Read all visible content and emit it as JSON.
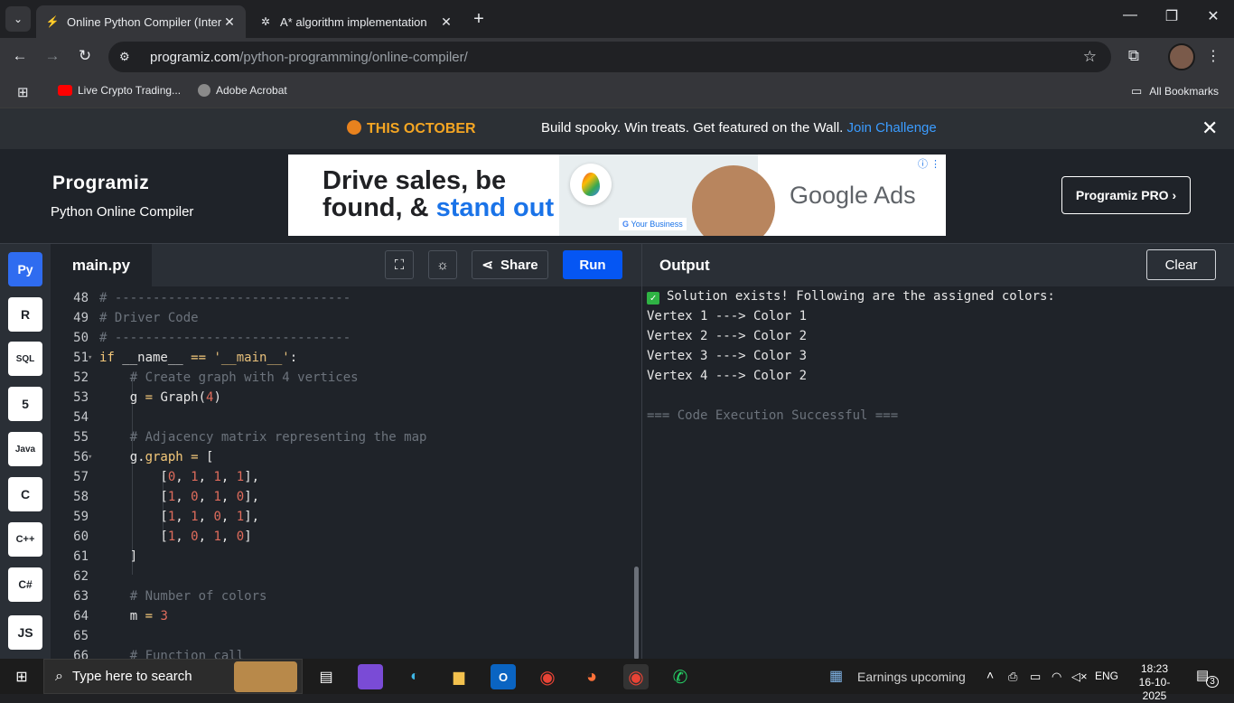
{
  "browser": {
    "tabs": [
      {
        "title": "Online Python Compiler (Interp",
        "close": "✕"
      },
      {
        "title": "A* algorithm implementation",
        "close": "✕"
      }
    ],
    "new_tab": "+",
    "url_host": "programiz.com",
    "url_path": "/python-programming/online-compiler/",
    "bookmarks": [
      "Live Crypto Trading...",
      "Adobe Acrobat"
    ],
    "all_bookmarks": "All Bookmarks"
  },
  "banner": {
    "highlight": "THIS OCTOBER",
    "message": "Build spooky. Win treats. Get featured on the Wall.",
    "link": "Join Challenge",
    "close": "✕"
  },
  "header": {
    "logo": "Programiz",
    "subtitle": "Python Online Compiler",
    "pro_button": "Programiz PRO ›"
  },
  "ad": {
    "line1": "Drive sales, be",
    "line2_plain": "found, & ",
    "line2_blue": "stand out",
    "brand": "Google Ads",
    "your_business": "Your Business"
  },
  "languages": [
    "Py",
    "R",
    "SQL",
    "5",
    "Java",
    "C",
    "C++",
    "C#",
    "JS"
  ],
  "editor": {
    "filename": "main.py",
    "share": "Share",
    "run": "Run",
    "lines": [
      {
        "n": "48",
        "fold": "",
        "html": "<span class='cm'># -------------------------------</span>"
      },
      {
        "n": "49",
        "fold": "",
        "html": "<span class='cm'># Driver Code</span>"
      },
      {
        "n": "50",
        "fold": "",
        "html": "<span class='cm'># -------------------------------</span>"
      },
      {
        "n": "51",
        "fold": "▾",
        "html": "<span class='kw'>if</span> __name__ <span class='kw'>==</span> <span class='st'>'__main__'</span>:"
      },
      {
        "n": "52",
        "fold": "",
        "html": "    <span class='cm'># Create graph with 4 vertices</span>"
      },
      {
        "n": "53",
        "fold": "",
        "html": "    g <span class='kw'>=</span> Graph(<span class='nu'>4</span>)"
      },
      {
        "n": "54",
        "fold": "",
        "html": ""
      },
      {
        "n": "55",
        "fold": "",
        "html": "    <span class='cm'># Adjacency matrix representing the map</span>"
      },
      {
        "n": "56",
        "fold": "▾",
        "html": "    g.<span class='kw'>graph</span> <span class='kw'>=</span> ["
      },
      {
        "n": "57",
        "fold": "",
        "html": "        [<span class='nu'>0</span>, <span class='nu'>1</span>, <span class='nu'>1</span>, <span class='nu'>1</span>],"
      },
      {
        "n": "58",
        "fold": "",
        "html": "        [<span class='nu'>1</span>, <span class='nu'>0</span>, <span class='nu'>1</span>, <span class='nu'>0</span>],"
      },
      {
        "n": "59",
        "fold": "",
        "html": "        [<span class='nu'>1</span>, <span class='nu'>1</span>, <span class='nu'>0</span>, <span class='nu'>1</span>],"
      },
      {
        "n": "60",
        "fold": "",
        "html": "        [<span class='nu'>1</span>, <span class='nu'>0</span>, <span class='nu'>1</span>, <span class='nu'>0</span>]"
      },
      {
        "n": "61",
        "fold": "",
        "html": "    ]"
      },
      {
        "n": "62",
        "fold": "",
        "html": ""
      },
      {
        "n": "63",
        "fold": "",
        "html": "    <span class='cm'># Number of colors</span>"
      },
      {
        "n": "64",
        "fold": "",
        "html": "    m <span class='kw'>=</span> <span class='nu'>3</span>"
      },
      {
        "n": "65",
        "fold": "",
        "html": ""
      },
      {
        "n": "66",
        "fold": "",
        "html": "    <span class='cm'># Function call</span>"
      }
    ]
  },
  "output": {
    "title": "Output",
    "clear": "Clear",
    "first_line": "Solution exists! Following are the assigned colors:",
    "lines": [
      "Vertex 1 ---> Color 1",
      "Vertex 2 ---> Color 2",
      "Vertex 3 ---> Color 3",
      "Vertex 4 ---> Color 2"
    ],
    "status": "=== Code Execution Successful ==="
  },
  "taskbar": {
    "search_placeholder": "Type here to search",
    "weather": "Earnings upcoming",
    "lang": "ENG",
    "time": "18:23",
    "date": "16-10-2025",
    "notifications": "3"
  }
}
